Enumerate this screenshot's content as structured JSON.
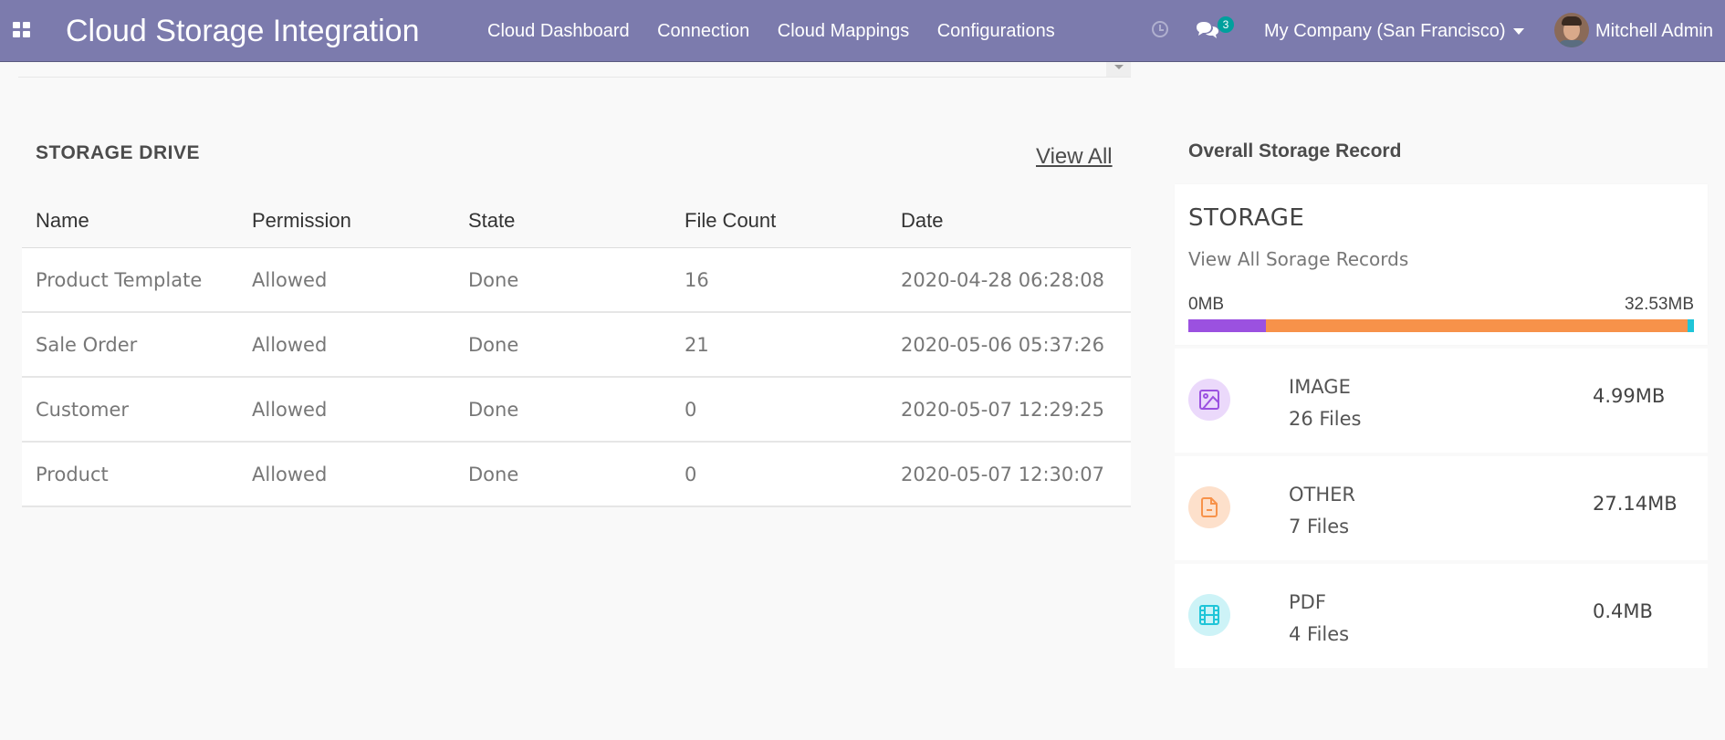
{
  "app": {
    "title": "Cloud Storage Integration"
  },
  "nav": {
    "items": [
      "Cloud Dashboard",
      "Connection",
      "Cloud Mappings",
      "Configurations"
    ],
    "messages_count": "3",
    "company": "My Company (San Francisco)",
    "user": "Mitchell Admin"
  },
  "drive": {
    "title": "STORAGE DRIVE",
    "view_all": "View All",
    "columns": [
      "Name",
      "Permission",
      "State",
      "File Count",
      "Date"
    ],
    "rows": [
      [
        "Product Template",
        "Allowed",
        "Done",
        "16",
        "2020-04-28 06:28:08"
      ],
      [
        "Sale Order",
        "Allowed",
        "Done",
        "21",
        "2020-05-06 05:37:26"
      ],
      [
        "Customer",
        "Allowed",
        "Done",
        "0",
        "2020-05-07 12:29:25"
      ],
      [
        "Product",
        "Allowed",
        "Done",
        "0",
        "2020-05-07 12:30:07"
      ]
    ]
  },
  "storage": {
    "section_title": "Overall Storage Record",
    "heading": "STORAGE",
    "link": "View All Sorage Records",
    "bar_min": "0MB",
    "bar_max": "32.53MB",
    "usage_bar": [
      {
        "type": "IMAGE",
        "mb": 4.99,
        "color": "#9b51e0"
      },
      {
        "type": "OTHER",
        "mb": 27.14,
        "color": "#f7924a"
      },
      {
        "type": "PDF",
        "mb": 0.4,
        "color": "#1fc5d8"
      }
    ],
    "types": [
      {
        "name": "IMAGE",
        "files": "26 Files",
        "size": "4.99MB",
        "icon": "image-icon",
        "color": "#9b51e0",
        "bg": "#ebd9fb"
      },
      {
        "name": "OTHER",
        "files": "7 Files",
        "size": "27.14MB",
        "icon": "document-icon",
        "color": "#f7924a",
        "bg": "#fde0cb"
      },
      {
        "name": "PDF",
        "files": "4 Files",
        "size": "0.4MB",
        "icon": "film-icon",
        "color": "#1fc5d8",
        "bg": "#cdf3f7"
      }
    ]
  }
}
